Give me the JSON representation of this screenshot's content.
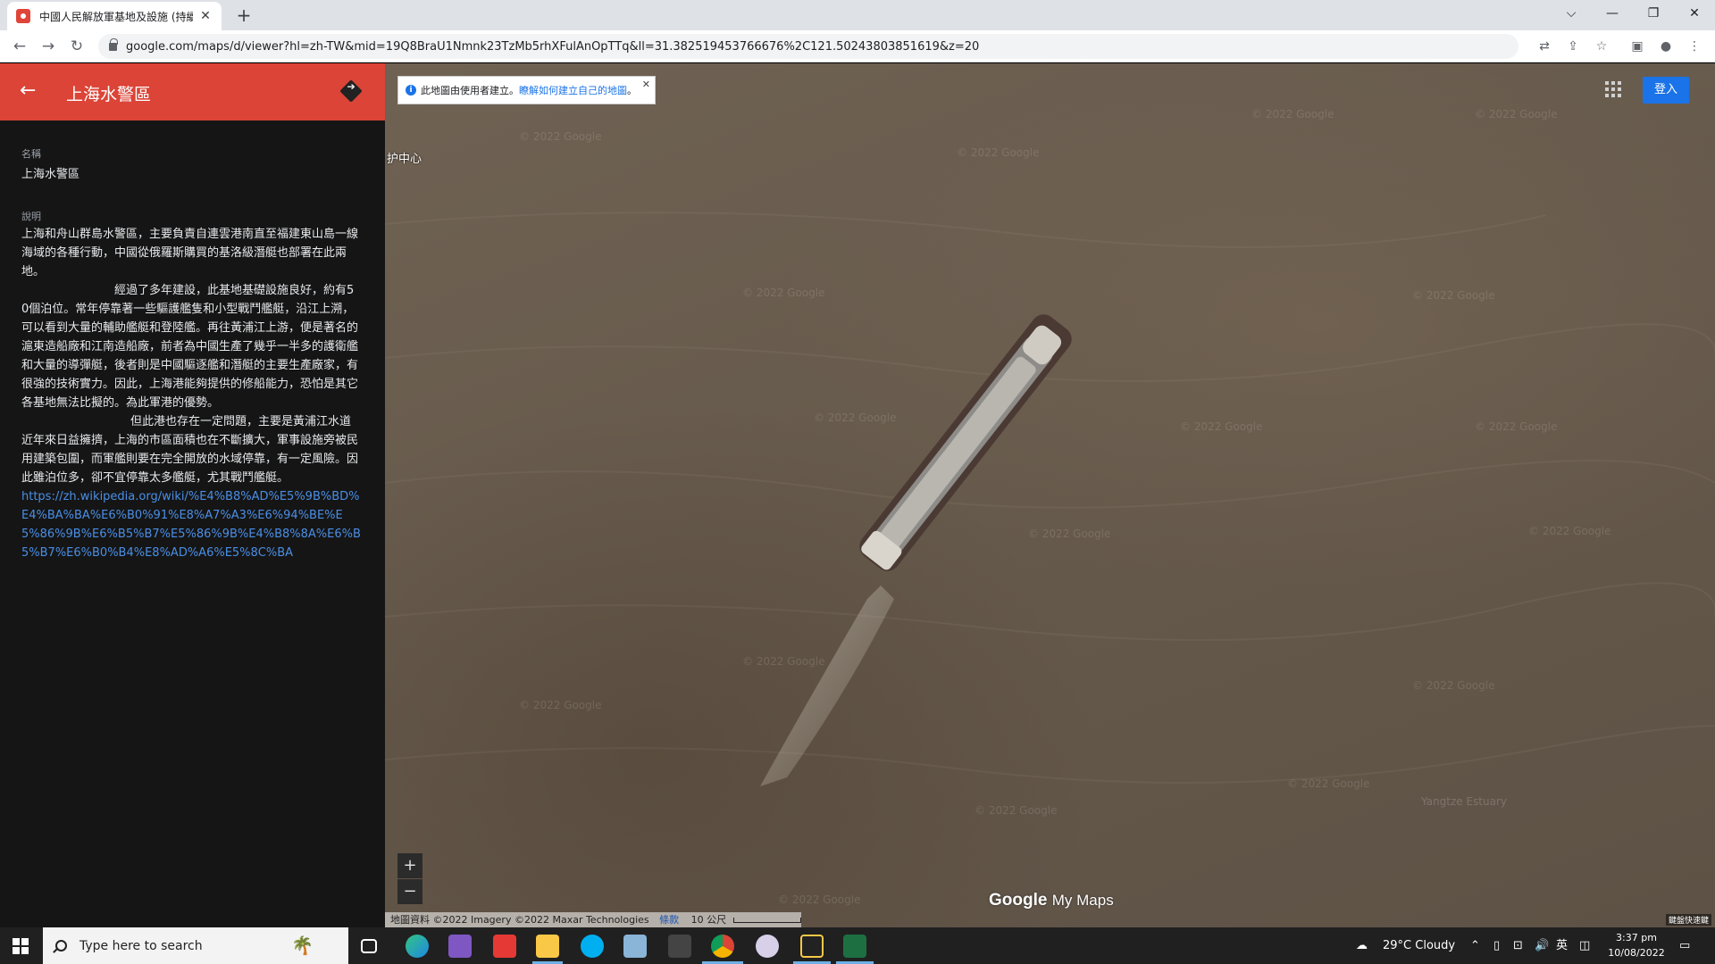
{
  "browser": {
    "tab_title": "中國人民解放軍基地及設施 (持續",
    "tab_close": "✕",
    "new_tab": "+",
    "url": "google.com/maps/d/viewer?hl=zh-TW&mid=19Q8BraU1Nmnk23TzMb5rhXFulAnOpTTq&ll=31.382519453766676%2C121.50243803851619&z=20",
    "controls": {
      "chevron": "⌵",
      "minimize": "—",
      "restore": "❐",
      "close": "✕"
    },
    "nav": {
      "back": "←",
      "forward": "→",
      "reload": "↻"
    }
  },
  "panel": {
    "title": "上海水警區",
    "name_label": "名稱",
    "name_value": "上海水警區",
    "desc_label": "說明",
    "paragraph1": "上海和舟山群島水警區，主要負責自連雲港南直至福建東山島一線海域的各種行動，中國從俄羅斯購買的基洛級潛艇也部署在此兩地。",
    "paragraph2": "經過了多年建設，此基地基礎設施良好，約有50個泊位。常年停靠著一些驅護艦隻和小型戰鬥艦艇，沿江上溯，可以看到大量的輔助艦艇和登陸艦。再往黃浦江上游，便是著名的滬東造船廠和江南造船廠，前者為中國生產了幾乎一半多的護衛艦和大量的導彈艇，後者則是中國驅逐艦和潛艇的主要生產廠家，有很強的技術實力。因此，上海港能夠提供的修船能力，恐怕是其它各基地無法比擬的。為此軍港的優勢。",
    "paragraph3": "但此港也存在一定問題，主要是黃浦江水道近年來日益擁擠，上海的市區面積也在不斷擴大，軍事設施旁被民用建築包圍，而軍艦則要在完全開放的水域停靠，有一定風險。因此雖泊位多，卻不宜停靠太多艦艇，尤其戰鬥艦艇。",
    "link": "https://zh.wikipedia.org/wiki/%E4%B8%AD%E5%9B%BD%E4%BA%BA%E6%B0%91%E8%A7%A3%E6%94%BE%E5%86%9B%E6%B5%B7%E5%86%9B%E4%B8%8A%E6%B5%B7%E6%B0%B4%E8%AD%A6%E5%8C%BA"
  },
  "map": {
    "info_prefix": "此地圖由使用者建立。",
    "info_link": "瞭解如何建立自己的地圖",
    "info_suffix": "。",
    "info_close": "✕",
    "place_label": "护中心",
    "signin": "登入",
    "zoom_in": "+",
    "zoom_out": "−",
    "logo_google": "Google",
    "logo_mymaps": "My Maps",
    "attribution": "地圖資料 ©2022 Imagery ©2022 Maxar Technologies",
    "terms": "條款",
    "scale": "10 公尺",
    "shortcut": "鍵盤快速鍵",
    "watermark_text": "© 2022 Google",
    "faint_label": "Yangtze Estuary"
  },
  "taskbar": {
    "search_placeholder": "Type here to search",
    "weather": "29°C  Cloudy",
    "ime": "英",
    "time": "3:37 pm",
    "date": "10/08/2022"
  },
  "colors": {
    "panel_header": "#db4437",
    "signin": "#1a73e8",
    "water": "#665a4c"
  }
}
